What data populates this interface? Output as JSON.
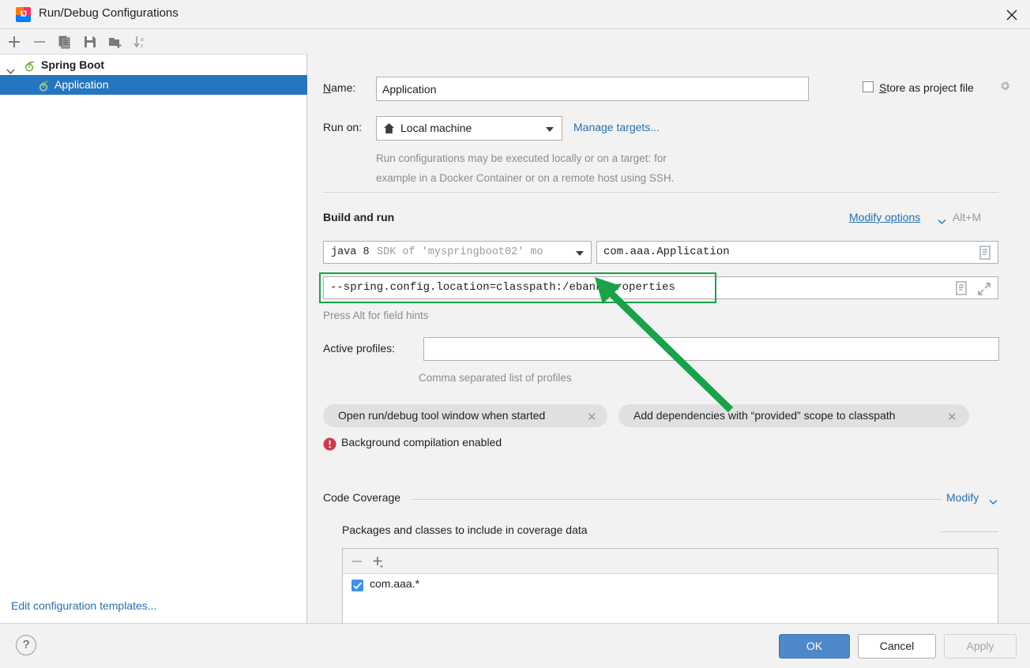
{
  "window": {
    "title": "Run/Debug Configurations",
    "app_icon": "intellij-idea-icon",
    "close_icon": "close-icon"
  },
  "left_panel": {
    "toolbar": [
      {
        "name": "add-configuration-button",
        "icon": "plus-icon",
        "tooltip": "Add New Configuration"
      },
      {
        "name": "remove-configuration-button",
        "icon": "minus-icon",
        "tooltip": "Remove Configuration"
      },
      {
        "name": "copy-configuration-button",
        "icon": "copy-icon",
        "tooltip": "Copy Configuration"
      },
      {
        "name": "save-configuration-button",
        "icon": "save-icon",
        "tooltip": "Save Configuration"
      },
      {
        "name": "move-to-folder-button",
        "icon": "folder-add-icon",
        "tooltip": "Move into new folder"
      },
      {
        "name": "sort-configurations-button",
        "icon": "sort-az-icon",
        "tooltip": "Sort Configurations"
      }
    ],
    "tree": [
      {
        "label": "Spring Boot",
        "icon": "spring-boot-icon",
        "expanded": true,
        "selected": false,
        "bold": true
      },
      {
        "label": "Application",
        "icon": "spring-boot-icon",
        "expanded": false,
        "selected": true,
        "bold": false
      }
    ],
    "edit_templates_link": "Edit configuration templates..."
  },
  "form": {
    "name_label": "Name:",
    "name_value": "Application",
    "store_as_project_file_label": "Store as project file",
    "store_as_project_file_checked": false,
    "gear_icon": "gear-icon",
    "run_on_label": "Run on:",
    "run_on_value": "Local machine",
    "run_on_icon": "home-icon",
    "manage_targets_link": "Manage targets...",
    "description_line1": "Run configurations may be executed locally or on a target: for",
    "description_line2": "example in a Docker Container or on a remote host using SSH."
  },
  "build_and_run": {
    "section_title": "Build and run",
    "modify_options_link": "Modify options",
    "modify_options_shortcut": "Alt+M",
    "jdk_value_strong": "java 8",
    "jdk_value_dim": "SDK of 'myspringboot02' mo",
    "main_class_value": "com.aaa.Application",
    "main_class_icon": "class-chooser-icon",
    "program_arguments_value": "--spring.config.location=classpath:/ebank.properties",
    "program_arguments_icon": "insert-macro-icon",
    "program_arguments_expand_icon": "expand-icon",
    "program_arguments_hint": "Press Alt for field hints",
    "active_profiles_label": "Active profiles:",
    "active_profiles_value": "",
    "active_profiles_hint": "Comma separated list of profiles",
    "option_chips": [
      {
        "label": "Open run/debug tool window when started",
        "remove_icon": "close-small-icon"
      },
      {
        "label": "Add dependencies with “provided” scope to classpath",
        "remove_icon": "close-small-icon"
      }
    ],
    "warning_icon": "error-icon",
    "warning_text": "Background compilation enabled"
  },
  "code_coverage": {
    "section_title": "Code Coverage",
    "modify_link": "Modify",
    "packages_title": "Packages and classes to include in coverage data",
    "toolbar": [
      {
        "name": "coverage-remove-button",
        "icon": "minus-icon"
      },
      {
        "name": "coverage-add-button",
        "icon": "plus-dropdown-icon"
      }
    ],
    "entries": [
      {
        "label": "com.aaa.*",
        "checked": true
      }
    ]
  },
  "bottom_bar": {
    "help_label": "?",
    "ok_label": "OK",
    "cancel_label": "Cancel",
    "apply_label": "Apply",
    "apply_enabled": false
  },
  "annotation": {
    "type": "arrow",
    "color": "#18a349",
    "highlight_color": "#18a349",
    "points_to": "program_arguments_field"
  }
}
